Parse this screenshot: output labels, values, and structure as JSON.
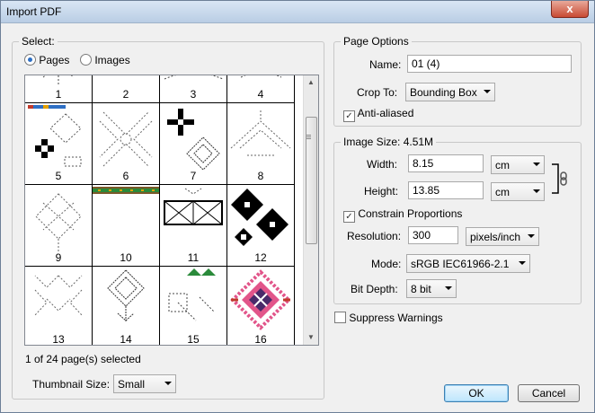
{
  "window": {
    "title": "Import PDF",
    "close_glyph": "x"
  },
  "select_group": {
    "legend": "Select:",
    "radio_pages": "Pages",
    "radio_images": "Images",
    "selected_mode": "Pages"
  },
  "thumbnails": {
    "pages": [
      "1",
      "2",
      "3",
      "4",
      "5",
      "6",
      "7",
      "8",
      "9",
      "10",
      "11",
      "12",
      "13",
      "14",
      "15",
      "16"
    ],
    "selected_page": "1",
    "status": "1 of 24 page(s) selected",
    "size_label": "Thumbnail Size:",
    "size_value": "Small"
  },
  "page_options": {
    "legend": "Page Options",
    "name_label": "Name:",
    "name_value": "01 (4)",
    "crop_label": "Crop To:",
    "crop_value": "Bounding Box",
    "antialias_label": "Anti-aliased",
    "antialias_checked": true
  },
  "image_size": {
    "legend": "Image Size: 4.51M",
    "width_label": "Width:",
    "width_value": "8.15",
    "width_unit": "cm",
    "height_label": "Height:",
    "height_value": "13.85",
    "height_unit": "cm",
    "constrain_label": "Constrain Proportions",
    "constrain_checked": true,
    "resolution_label": "Resolution:",
    "resolution_value": "300",
    "resolution_unit": "pixels/inch",
    "mode_label": "Mode:",
    "mode_value": "sRGB IEC61966-2.1",
    "bitdepth_label": "Bit Depth:",
    "bitdepth_value": "8 bit"
  },
  "suppress_warnings": {
    "label": "Suppress Warnings",
    "checked": false
  },
  "buttons": {
    "ok": "OK",
    "cancel": "Cancel"
  },
  "colors": {
    "accent": "#2e6fc4",
    "pattern_red": "#c0392b",
    "pattern_pink": "#e2558a",
    "pattern_green": "#2a8a3a"
  }
}
